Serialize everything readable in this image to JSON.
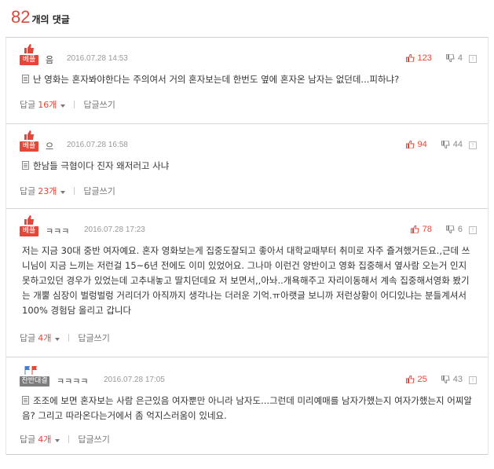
{
  "header": {
    "count": "82",
    "label": "개의 댓글"
  },
  "comments": [
    {
      "badge": "베플",
      "author": "음",
      "date": "2016.07.28 14:53",
      "up": "123",
      "down": "4",
      "report": "신고",
      "text": "난 영화는 혼자봐야한다는 주의여서 거의 혼자보는데 한번도 옆에 혼자온 남자는 없던데...피하냐?",
      "reply_label": "답글",
      "reply_count": "16개",
      "write_label": "답글쓰기"
    },
    {
      "badge": "베플",
      "author": "으",
      "date": "2016.07.28 16:58",
      "up": "94",
      "down": "44",
      "report": "신고",
      "text": "한남들 극혐이다 진자 왜저러고 사냐",
      "reply_label": "답글",
      "reply_count": "23개",
      "write_label": "답글쓰기"
    },
    {
      "badge": "베플",
      "author": "ㅋㅋㅋ",
      "date": "2016.07.28 17:23",
      "up": "78",
      "down": "6",
      "report": "신고",
      "text": "저는 지금 30대 중반 여자예요. 혼자 영화보는게 집중도잘되고 좋아서 대학교때부터 취미로 자주 즐겨했거든요.,근데 쓰니님이 지금 느끼는 저런걸 15~6년 전에도 이미 있었어요. 그나마 이런건 양반이고 영화 집중해서 옆사람 오는거 인지 못하고있던 경우가 있었는데 고추내놓고 딸치던데요 저 보면서,,아놔..개욕해주고 자리이동해서 계속 집중해서영화 봤기는 개뿔 심장이 벌렁벌렁 거리더가 아직까지 생각나는 더러운 기억.ㅠ아랫글 보니까 저런상황이 어디있냐는 분들계셔서 100% 경험담 올리고 갑니다",
      "reply_label": "답글",
      "reply_count": "4개",
      "write_label": "답글쓰기"
    },
    {
      "badge": "찬반대결",
      "author": "ㅋㅋㅋㅋ",
      "date": "2016.07.28 17:05",
      "up": "25",
      "down": "43",
      "report": "신고",
      "text": "조조에 보면 혼자보는 사람 은근있음 여자뿐만 아니라 남자도...그런데 미리예매를 남자가했는지 여자가했는지 어찌알음? 그리고 따라온다는거에서 좀 억지스러움이 있네요.",
      "reply_label": "답글",
      "reply_count": "4개",
      "write_label": "답글쓰기"
    }
  ]
}
